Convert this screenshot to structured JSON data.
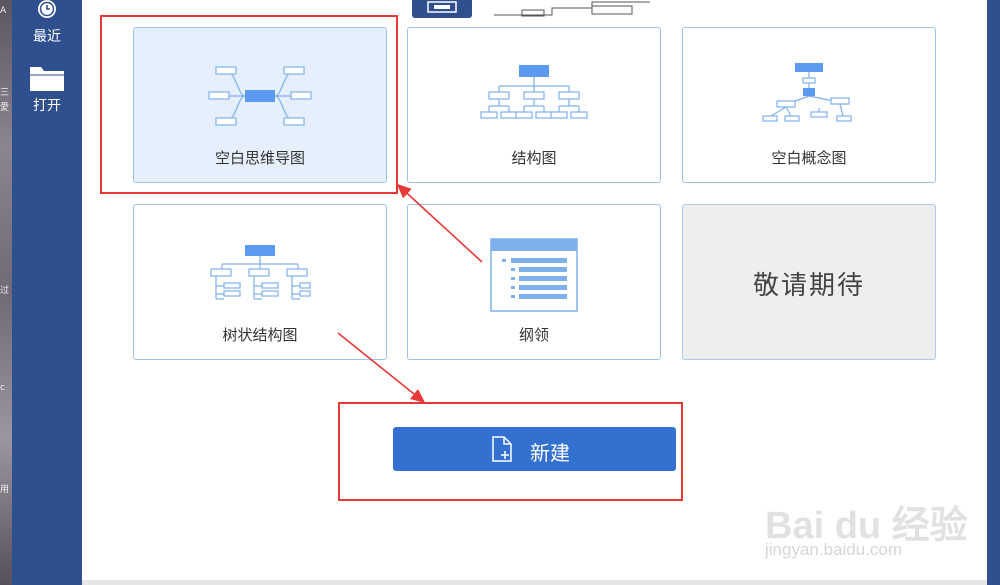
{
  "edge_chars": [
    "A",
    "三",
    "愛",
    "过",
    "c",
    "用"
  ],
  "sidebar": {
    "items": [
      {
        "label": "最近",
        "icon": "clock-icon"
      },
      {
        "label": "打开",
        "icon": "folder-icon"
      }
    ]
  },
  "templates": [
    {
      "label": "空白思维导图",
      "icon": "mind-map-icon",
      "selected": true
    },
    {
      "label": "结构图",
      "icon": "org-chart-icon"
    },
    {
      "label": "空白概念图",
      "icon": "concept-map-icon"
    },
    {
      "label": "树状结构图",
      "icon": "tree-chart-icon"
    },
    {
      "label": "纲领",
      "icon": "outline-icon"
    },
    {
      "label": "敬请期待",
      "disabled": true
    }
  ],
  "new_button": {
    "label": "新建",
    "icon": "new-file-icon"
  },
  "watermark": {
    "logo": "Bai du 经验",
    "url": "jingyan.baidu.com"
  },
  "colors": {
    "sidebar": "#2f4f8f",
    "accent": "#3371d1",
    "card_border": "#9cc3ee",
    "selected_bg": "#e6f0fc",
    "annotation": "#e53935"
  }
}
